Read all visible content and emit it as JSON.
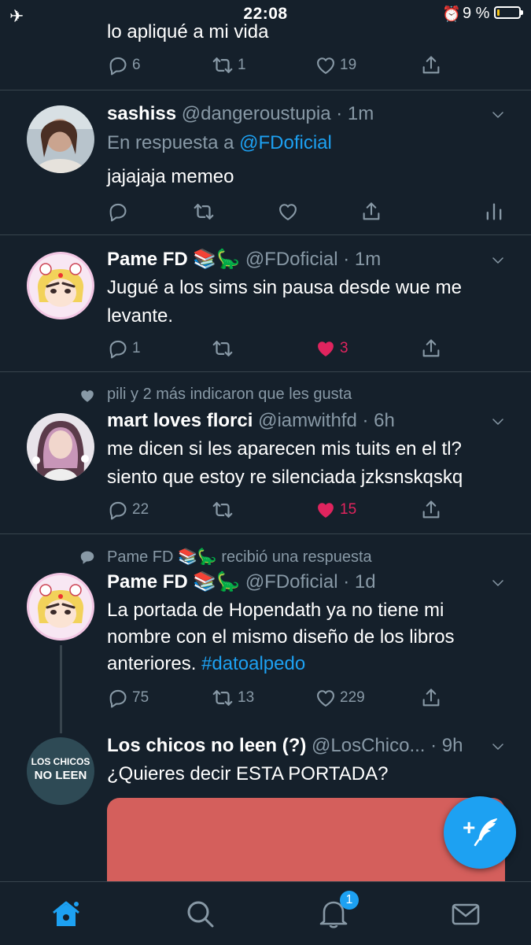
{
  "status_bar": {
    "time": "22:08",
    "battery_percent": "9 %",
    "battery_level": 0.09,
    "alarm_icon": "alarm-clock-icon",
    "airplane_icon": "airplane-icon"
  },
  "colors": {
    "background": "#15202b",
    "accent": "#1da1f2",
    "like": "#e0245e",
    "muted": "#8899a6",
    "divider": "#38444d"
  },
  "timeline": {
    "partial_tweet": {
      "text": "lo apliqué a mi vida",
      "replies": "6",
      "retweets": "1",
      "likes": "19"
    },
    "tweets": [
      {
        "name": "sashiss",
        "handle": "@dangeroustupia",
        "time": "1m",
        "reply_prefix": "En respuesta a ",
        "reply_to": "@FDoficial",
        "text": "jajajaja memeo",
        "replies": "",
        "retweets": "",
        "likes": ""
      },
      {
        "name": "Pame FD 📚🦕",
        "handle": "@FDoficial",
        "time": "1m",
        "text_line1": "Jugué a los sims sin pausa desde wue me",
        "text_line2": "levante.",
        "replies": "1",
        "retweets": "",
        "likes": "3",
        "liked": true
      },
      {
        "context": "pili y 2 más indicaron que les gusta",
        "name": "mart loves florci",
        "handle": "@iamwithfd",
        "time": "6h",
        "text_line1": "me dicen si les aparecen mis tuits en el tl?",
        "text_line2": "siento que estoy re silenciada jzksnskqskq",
        "replies": "22",
        "retweets": "",
        "likes": "15",
        "liked": true
      },
      {
        "context_name": "Pame FD 📚🦕",
        "context_suffix": "recibió una respuesta",
        "name": "Pame FD 📚🦕",
        "handle": "@FDoficial",
        "time": "1d",
        "text_line1": "La portada de Hopendath ya no tiene mi",
        "text_line2": "nombre con el mismo diseño de los libros",
        "text_line3_plain": "anteriores. ",
        "hashtag": "#datoalpedo",
        "replies": "75",
        "retweets": "13",
        "likes": "229"
      },
      {
        "name": "Los chicos no leen (?)",
        "handle": "@LosChico...",
        "time": "9h",
        "text": "¿Quieres decir ESTA PORTADA?",
        "avatar_text_line1": "LOS CHICOS",
        "avatar_text_line2": "NO LEEN"
      }
    ]
  },
  "fab": {
    "icon": "compose-tweet-icon",
    "plus": "+"
  },
  "tabbar": {
    "items": [
      "home-icon",
      "search-icon",
      "notifications-icon",
      "messages-icon"
    ],
    "notifications_badge": "1"
  }
}
